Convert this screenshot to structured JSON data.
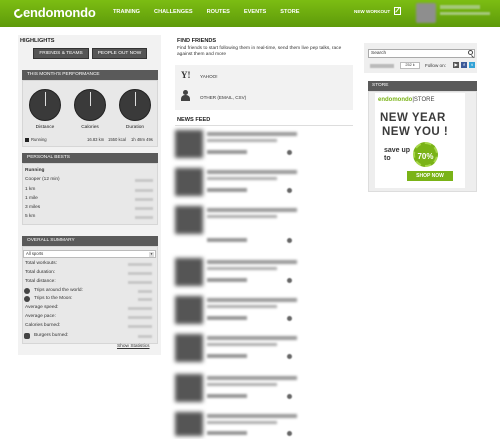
{
  "header": {
    "logo": "endomondo",
    "nav": [
      "TRAINING",
      "CHALLENGES",
      "ROUTES",
      "EVENTS",
      "STORE"
    ],
    "new_workout": "NEW WORKOUT"
  },
  "highlights": {
    "title": "HIGHLIGHTS",
    "btn_friends": "FRIENDS & TEAMS",
    "btn_people": "PEOPLE OUT NOW"
  },
  "performance": {
    "title": "THIS MONTH'S PERFORMANCE",
    "gauges": [
      "Distance",
      "Calories",
      "Duration"
    ],
    "sport": "Running",
    "distance": "16.83 km",
    "calories": "1550 kcal",
    "duration": "1h 48m 49s"
  },
  "bests": {
    "title": "PERSONAL BESTS",
    "sport": "Running",
    "rows": [
      "Cooper (12 min)",
      "1 km",
      "1 mile",
      "3 miles",
      "5 km"
    ]
  },
  "summary": {
    "title": "OVERALL SUMMARY",
    "filter": "All sports",
    "rows": [
      "Total workouts:",
      "Total duration:",
      "Total distance:",
      "Trips around the world:",
      "Trips to the Moon:",
      "Average speed:",
      "Average pace:",
      "Calories burned:",
      "Burgers burned:"
    ],
    "show_stats": "Show Statistics"
  },
  "find_friends": {
    "title": "FIND FRIENDS",
    "text": "Find friends to start following them in real-time, send them live pep talks, race against them and more",
    "yahoo": "YAHOO!",
    "other": "OTHER (EMAIL, CSV)"
  },
  "feed": {
    "title": "NEWS FEED"
  },
  "right": {
    "search_placeholder": "Search",
    "fb_count": "252 k",
    "follow_label": "Follow on:",
    "store_title": "STORE",
    "ad_logo_a": "endomondo",
    "ad_logo_b": "|STORE",
    "ad_line1": "NEW YEAR",
    "ad_line2": "NEW YOU !",
    "ad_save": "save up to",
    "ad_badge": "70%",
    "ad_shop": "SHOP NOW"
  },
  "colors": {
    "brand": "#6aa60d",
    "panel_head": "#5a5a5a"
  }
}
